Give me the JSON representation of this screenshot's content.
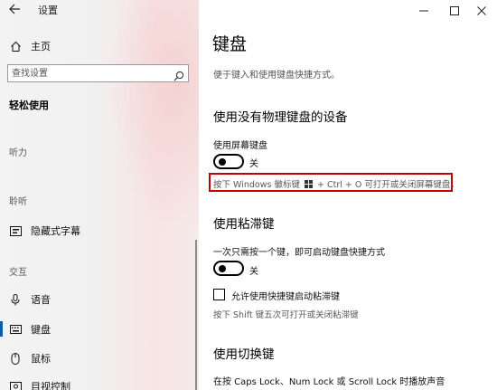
{
  "window": {
    "title": "设置",
    "buttons": {
      "minimize": "minimize-icon",
      "maximize": "maximize-icon",
      "close": "close-icon"
    }
  },
  "nav": {
    "home": "主页",
    "search_placeholder": "查找设置",
    "category": "轻松使用",
    "groups": {
      "vision_partial": "听力",
      "hearing": "聆听",
      "interaction": "交互"
    },
    "items": {
      "captions": "隐藏式字幕",
      "speech": "语音",
      "keyboard": "键盘",
      "mouse": "鼠标",
      "eye_control": "目视控制"
    },
    "selected": "键盘"
  },
  "main": {
    "title": "键盘",
    "description": "便于键入和使用键盘快捷方式。",
    "osk": {
      "heading": "使用没有物理键盘的设备",
      "label": "使用屏幕键盘",
      "toggle_state": "关",
      "hint_part1": "按下 Windows 徽标键",
      "hint_part2": "+ Ctrl + O 可打开或关闭屏幕键盘。"
    },
    "sticky": {
      "heading": "使用粘滞键",
      "label": "一次只需按一个键，即可启动键盘快捷方式",
      "toggle_state": "关",
      "checkbox_label": "允许使用快捷键启动粘滞键",
      "hint": "按下 Shift 键五次可打开或关闭粘滞键"
    },
    "toggle_keys": {
      "heading": "使用切换键",
      "label": "在按 Caps Lock、Num Lock 或 Scroll Lock 时播放声音"
    }
  },
  "colors": {
    "accent": "#0b5cad",
    "highlight_border": "#c00000"
  }
}
